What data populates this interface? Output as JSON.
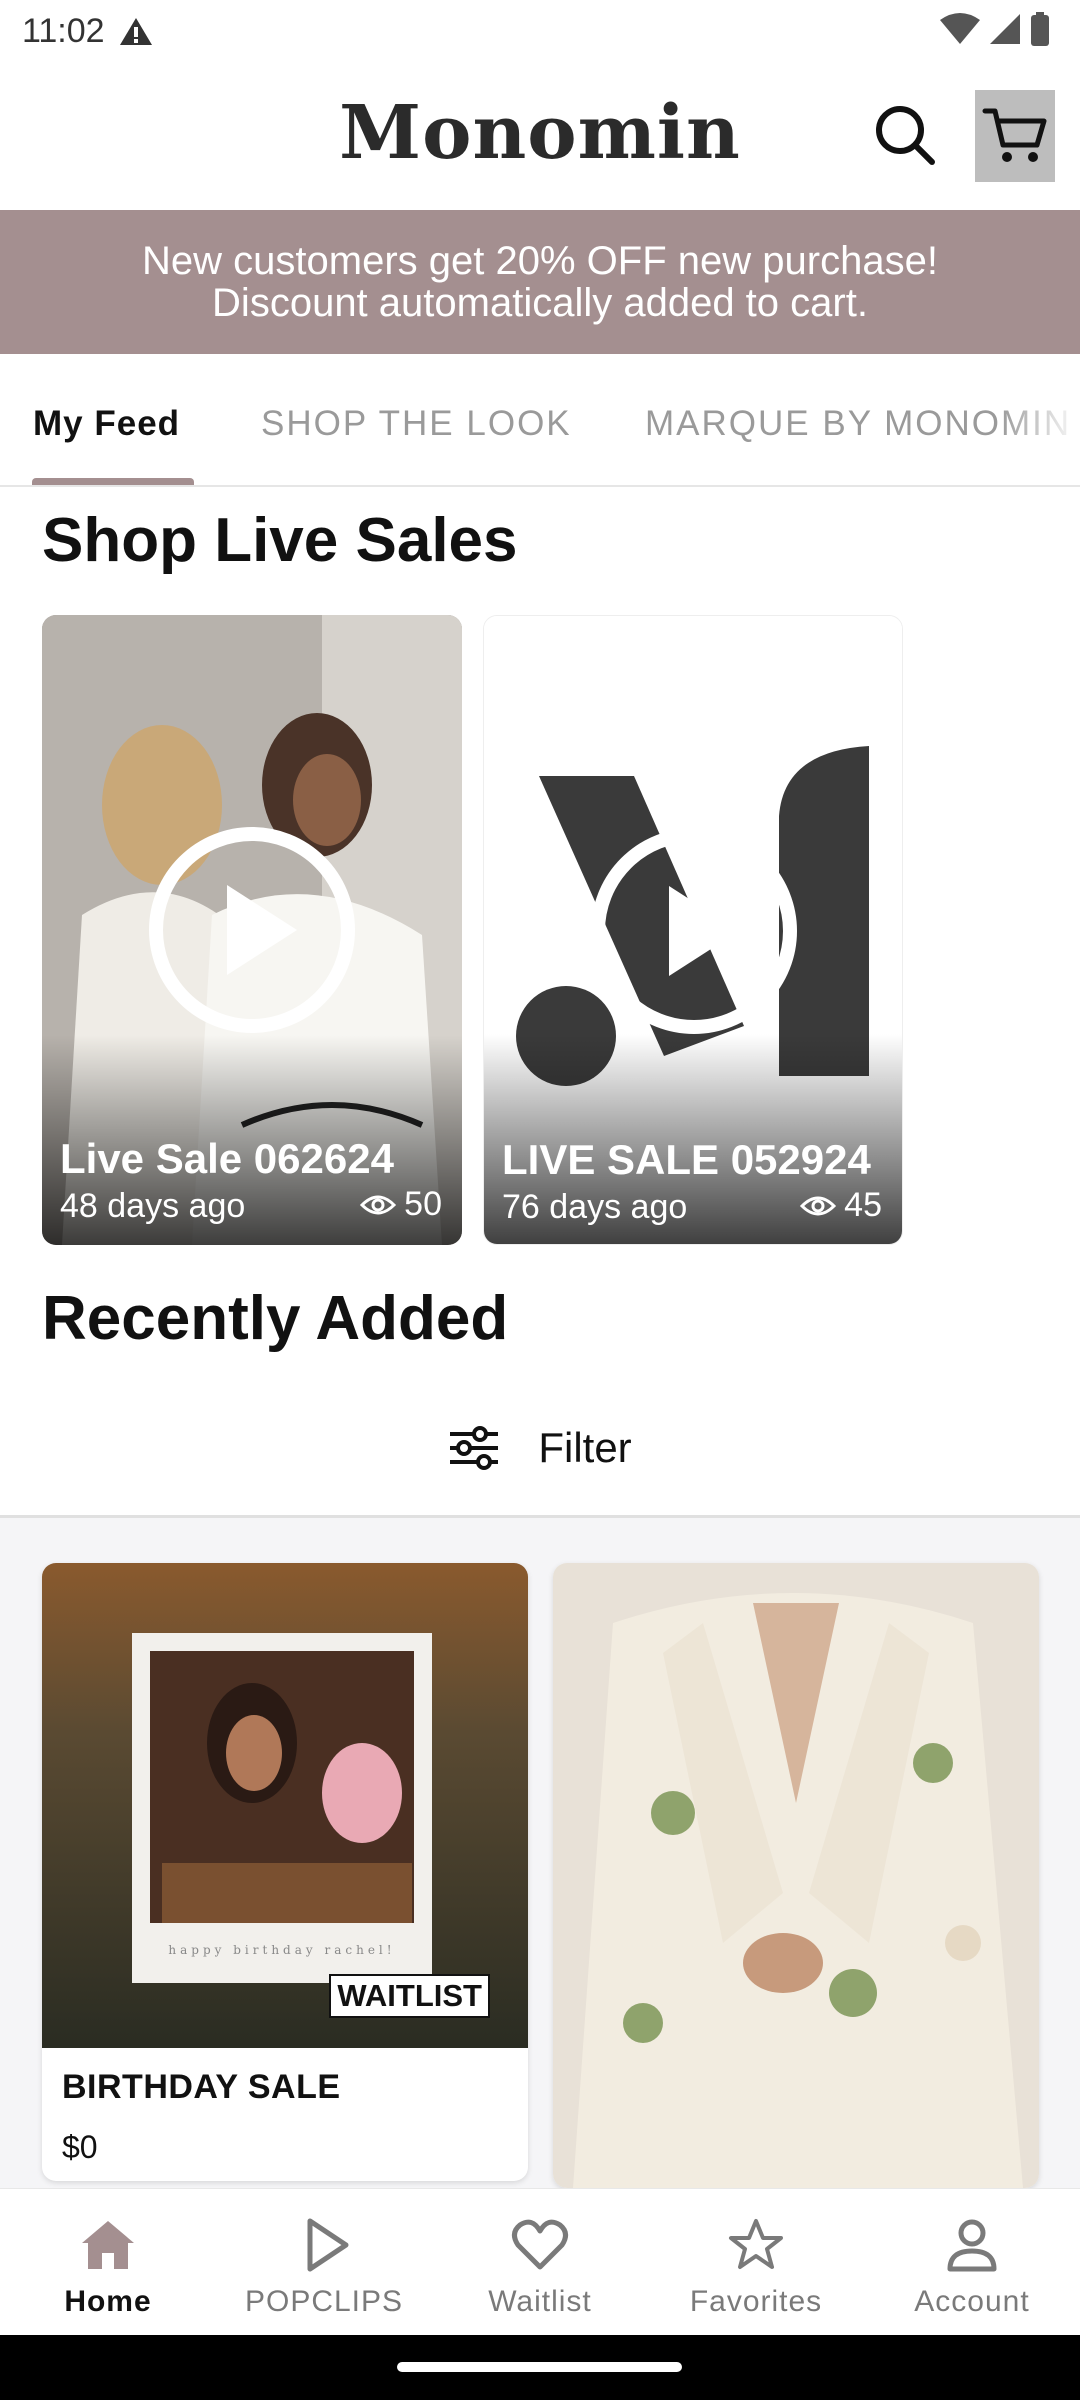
{
  "status_bar": {
    "time": "11:02"
  },
  "header": {
    "logo": "Monomin"
  },
  "promo": {
    "line1": "New customers get 20% OFF new purchase!",
    "line2": "Discount automatically added to cart."
  },
  "tabs": [
    {
      "label": "My Feed",
      "active": true
    },
    {
      "label": "SHOP THE LOOK",
      "active": false
    },
    {
      "label": "MARQUE BY MONOMIN",
      "active": false
    }
  ],
  "live_sales": {
    "title": "Shop Live Sales",
    "items": [
      {
        "title": "Live Sale 062624",
        "age": "48 days ago",
        "views": "50"
      },
      {
        "title": "LIVE SALE 052924",
        "age": "76 days ago",
        "views": "45"
      }
    ]
  },
  "recently_added": {
    "title": "Recently Added",
    "filter_label": "Filter",
    "products": [
      {
        "name": "BIRTHDAY SALE",
        "price": "$0",
        "badge": "WAITLIST",
        "caption": "happy birthday rachel!"
      },
      {
        "name": "",
        "price": ""
      }
    ]
  },
  "bottom_nav": [
    {
      "label": "Home",
      "icon": "home-icon",
      "active": true
    },
    {
      "label": "POPCLIPS",
      "icon": "play-icon",
      "active": false
    },
    {
      "label": "Waitlist",
      "icon": "heart-icon",
      "active": false
    },
    {
      "label": "Favorites",
      "icon": "star-icon",
      "active": false
    },
    {
      "label": "Account",
      "icon": "account-icon",
      "active": false
    }
  ],
  "colors": {
    "accent": "#a48f90",
    "text": "#111111",
    "muted": "#9a9a9a"
  }
}
